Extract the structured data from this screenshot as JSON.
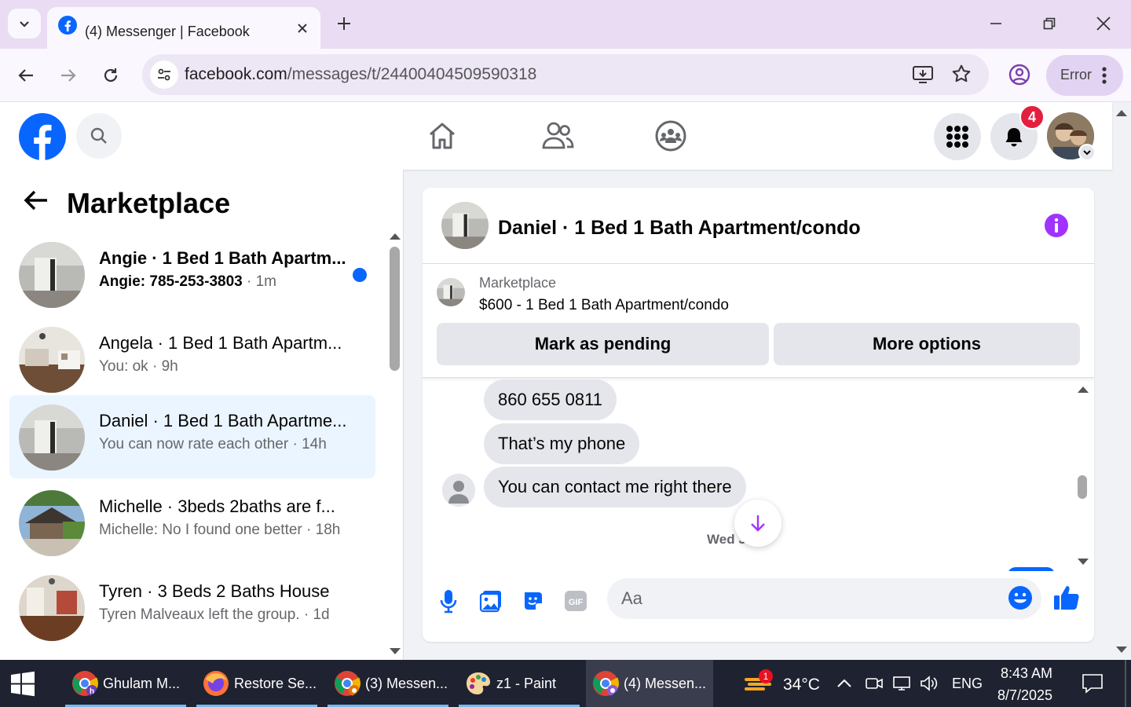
{
  "browser": {
    "tab_title": "(4) Messenger | Facebook",
    "url_domain": "facebook.com",
    "url_path": "/messages/t/24400404509590318",
    "profile_button_label": "Error"
  },
  "fb_header": {
    "notification_count": "4"
  },
  "sidebar": {
    "title": "Marketplace",
    "conversations": [
      {
        "name": "Angie · 1 Bed 1 Bath Apartm...",
        "preview": "Angie: 785-253-3803",
        "time": " · 1m",
        "unread": true
      },
      {
        "name": "Angela · 1 Bed 1 Bath Apartm...",
        "preview": "You: ok",
        "time": " · 9h",
        "unread": false
      },
      {
        "name": "Daniel · 1 Bed 1 Bath Apartme...",
        "preview": "You can now rate each other",
        "time": " · 14h",
        "unread": false
      },
      {
        "name": "Michelle · 3beds 2baths are f...",
        "preview": "Michelle: No I found one better",
        "time": " · 18h",
        "unread": false
      },
      {
        "name": "Tyren · 3 Beds 2 Baths House",
        "preview": "Tyren Malveaux left the group.",
        "time": " · 1d",
        "unread": false
      }
    ]
  },
  "chat": {
    "title": "Daniel · 1 Bed 1 Bath Apartment/condo",
    "listing_label": "Marketplace",
    "listing_title": "$600 - 1 Bed 1 Bath Apartment/condo",
    "mark_pending_label": "Mark as pending",
    "more_options_label": "More options",
    "messages": [
      "860 655 0811",
      "That’s my phone",
      "You can contact me right there"
    ],
    "timestamp": "Wed 3 PM",
    "input_placeholder": "Aa"
  },
  "taskbar": {
    "items": [
      {
        "label": "Ghulam M...",
        "color": "#4285f4"
      },
      {
        "label": "Restore Se...",
        "color": "#ff7139"
      },
      {
        "label": "(3) Messen...",
        "color": "#4285f4"
      },
      {
        "label": "z1 - Paint",
        "color": "#f4b400"
      },
      {
        "label": "(4) Messen...",
        "color": "#4285f4"
      }
    ],
    "weather_badge": "1",
    "temperature": "34°C",
    "language": "ENG",
    "time": "8:43 AM",
    "date": "8/7/2025"
  },
  "colors": {
    "fb_blue": "#0866ff",
    "messenger_purple": "#a033ff",
    "badge_red": "#e41e3f"
  }
}
